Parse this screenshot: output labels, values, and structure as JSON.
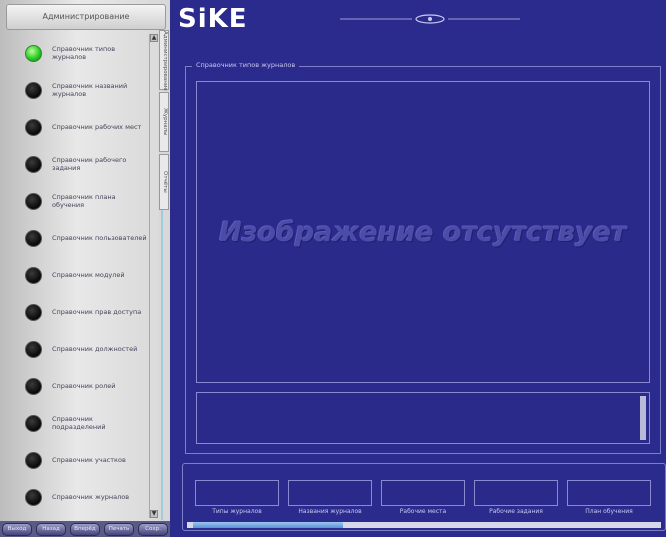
{
  "sidebar": {
    "title": "Администрирование",
    "items": [
      {
        "label": "Справочник типов журналов",
        "active": true
      },
      {
        "label": "Справочник названий журналов",
        "active": false
      },
      {
        "label": "Справочник рабочих мест",
        "active": false
      },
      {
        "label": "Справочник рабочего задания",
        "active": false
      },
      {
        "label": "Справочник плана обучения",
        "active": false
      },
      {
        "label": "Справочник пользователей",
        "active": false
      },
      {
        "label": "Справочник модулей",
        "active": false
      },
      {
        "label": "Справочник прав доступа",
        "active": false
      },
      {
        "label": "Справочник должностей",
        "active": false
      },
      {
        "label": "Справочник ролей",
        "active": false
      },
      {
        "label": "Справочник подразделений",
        "active": false
      },
      {
        "label": "Справочник участков",
        "active": false
      },
      {
        "label": "Справочник журналов",
        "active": false
      }
    ],
    "vertical_tabs": [
      "Администрирование",
      "Журналы",
      "Отчёты"
    ],
    "bottom_buttons": [
      "Выход",
      "Назад",
      "Вперёд",
      "Печать",
      "Сохр."
    ]
  },
  "header": {
    "logo": "SiKE"
  },
  "main": {
    "group_title": "Справочник типов журналов",
    "image_placeholder": "Изображение отсутствует",
    "fields": [
      "Типы журналов",
      "Названия журналов",
      "Рабочие места",
      "Рабочие задания",
      "План обучения"
    ]
  },
  "colors": {
    "main_bg": "#2b2b8e",
    "active_led": "#23c51c",
    "inactive_led": "#080808"
  }
}
